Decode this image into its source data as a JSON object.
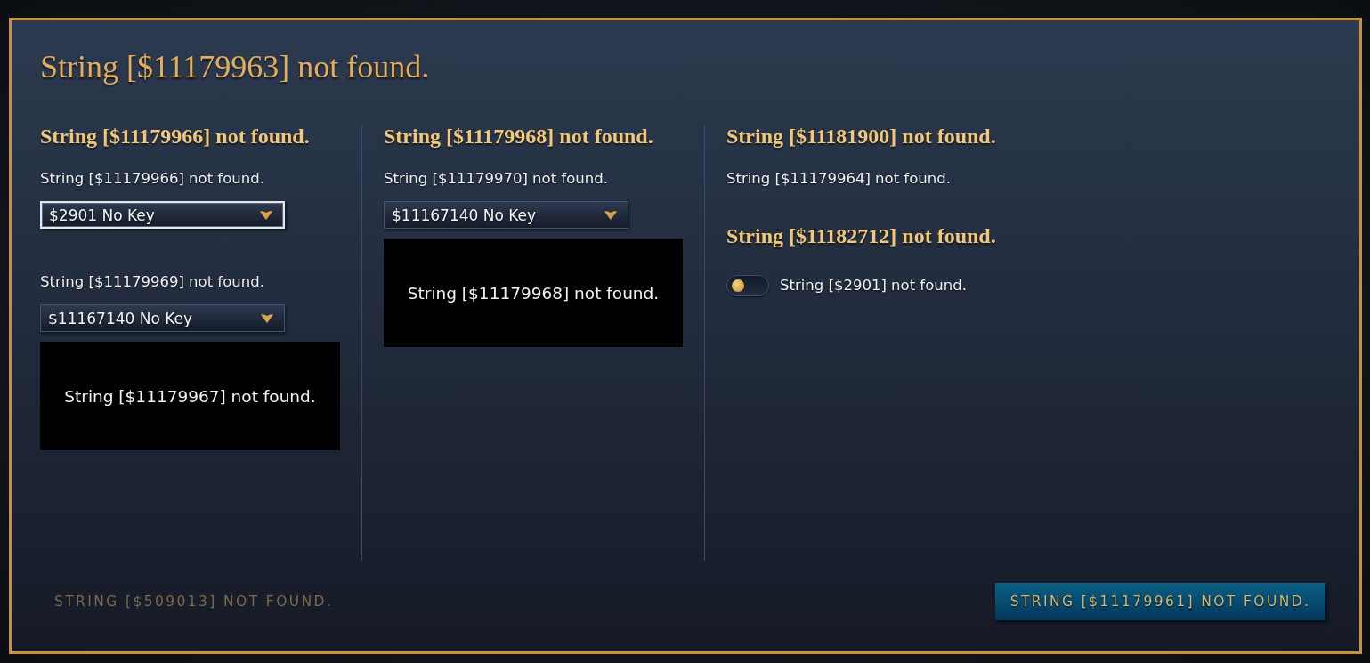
{
  "dialog": {
    "title": "String [$11179963] not found."
  },
  "columns": [
    {
      "sections": [
        {
          "heading": "String [$11179966] not found.",
          "controls": [
            {
              "kind": "dropdown",
              "label": "String [$11179966] not found.",
              "value": "$2901 No Key",
              "focused": true
            },
            {
              "kind": "dropdown",
              "label": "String [$11179969] not found.",
              "value": "$11167140 No Key",
              "focused": false,
              "preview": "String [$11179967] not found."
            }
          ]
        }
      ]
    },
    {
      "sections": [
        {
          "heading": "String [$11179968] not found.",
          "controls": [
            {
              "kind": "dropdown",
              "label": "String [$11179970] not found.",
              "value": "$11167140 No Key",
              "focused": false,
              "preview": "String [$11179968] not found."
            }
          ]
        }
      ]
    },
    {
      "sections": [
        {
          "heading": "String [$11181900] not found.",
          "controls": [
            {
              "kind": "text",
              "text": "String [$11179964] not found."
            }
          ]
        },
        {
          "heading": "String [$11182712] not found.",
          "controls": [
            {
              "kind": "toggle",
              "label": "String [$2901] not found.",
              "on": false
            }
          ]
        }
      ]
    }
  ],
  "footer": {
    "secondary_button": {
      "label": "STRING [$509013] NOT FOUND.",
      "disabled": true
    },
    "primary_button": {
      "label": "STRING [$11179961] NOT FOUND."
    }
  }
}
